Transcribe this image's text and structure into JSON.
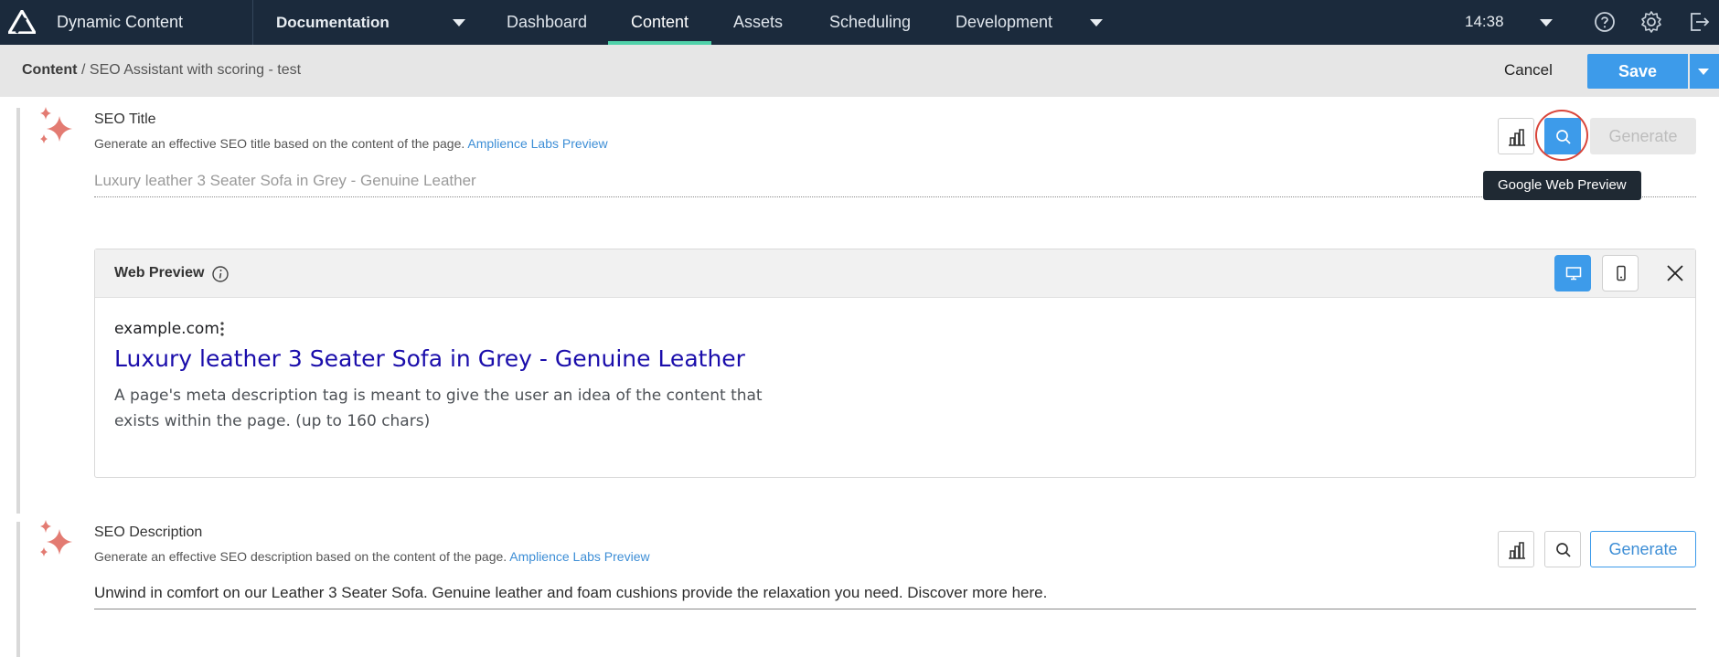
{
  "header": {
    "app_title": "Dynamic Content",
    "hub": "Documentation",
    "nav": [
      "Dashboard",
      "Content",
      "Assets",
      "Scheduling",
      "Development"
    ],
    "active_nav": "Content",
    "time": "14:38",
    "icons": [
      "help-icon",
      "settings-icon",
      "logout-icon"
    ]
  },
  "subbar": {
    "breadcrumb_root": "Content",
    "breadcrumb_rest": "/ SEO Assistant with scoring - test",
    "cancel_label": "Cancel",
    "save_label": "Save"
  },
  "seo_title": {
    "label": "SEO Title",
    "description": "Generate an effective SEO title based on the content of the page.",
    "link": "Amplience Labs Preview",
    "value": "Luxury leather 3 Seater Sofa in Grey - Genuine Leather",
    "generate_label": "Generate",
    "tooltip": "Google Web Preview"
  },
  "web_preview": {
    "title": "Web Preview",
    "site": "example.com",
    "result_title": "Luxury leather 3 Seater Sofa in Grey - Genuine Leather",
    "result_desc": "A page's meta description tag is meant to give the user an idea of the content that exists within the page. (up to 160 chars)"
  },
  "seo_description": {
    "label": "SEO Description",
    "description": "Generate an effective SEO description based on the content of the page.",
    "link": "Amplience Labs Preview",
    "value": "Unwind in comfort on our Leather 3 Seater Sofa. Genuine leather and foam cushions provide the relaxation you need. Discover more here.",
    "generate_label": "Generate"
  },
  "colors": {
    "topbar": "#1b2a3c",
    "accent": "#3d9bea",
    "nav_active": "#4fd1a9",
    "sparkle": "#e37b72",
    "highlight": "#d9463b"
  }
}
